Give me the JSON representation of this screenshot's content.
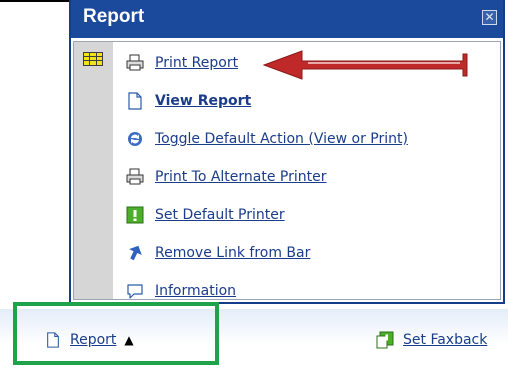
{
  "popup": {
    "title": "Report",
    "close_icon": "close-x-icon",
    "items": [
      {
        "label": "Print Report",
        "icon": "printer-icon",
        "bold": false
      },
      {
        "label": "View Report",
        "icon": "document-icon",
        "bold": true
      },
      {
        "label": "Toggle Default Action (View or Print)",
        "icon": "toggle-icon",
        "bold": false
      },
      {
        "label": "Print To Alternate Printer",
        "icon": "printer-icon",
        "bold": false
      },
      {
        "label": "Set Default Printer",
        "icon": "default-printer-icon",
        "bold": false
      },
      {
        "label": "Remove Link from Bar",
        "icon": "pin-icon",
        "bold": false
      },
      {
        "label": "Information",
        "icon": "speech-bubble-icon",
        "bold": false
      }
    ]
  },
  "bottom_bar": {
    "report_label": "Report",
    "report_caret": "▲",
    "faxback_label": "Set Faxback"
  },
  "colors": {
    "header": "#1b4a9c",
    "link": "#1a3c8a",
    "highlight_box": "#1fa34a",
    "arrow": "#c0292a"
  }
}
